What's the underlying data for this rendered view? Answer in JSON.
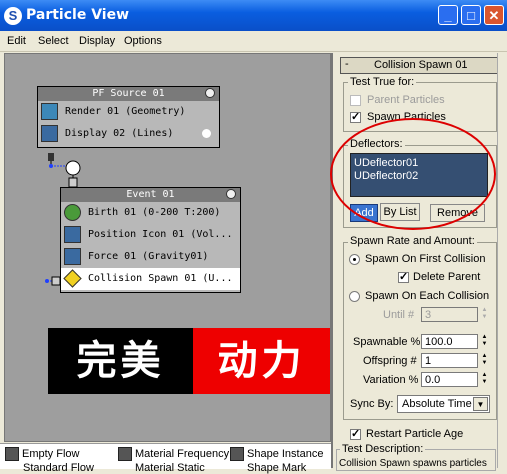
{
  "window": {
    "title": "Particle View",
    "app_icon": "3ds-max-logo"
  },
  "menu": [
    "Edit",
    "Select",
    "Display",
    "Options"
  ],
  "nodes": {
    "source": {
      "title": "PF Source 01",
      "rows": [
        "Render 01 (Geometry)",
        "Display 02 (Lines)"
      ]
    },
    "event": {
      "title": "Event 01",
      "rows": [
        "Birth 01 (0-200 T:200)",
        "Position Icon 01 (Vol...",
        "Force 01 (Gravity01)",
        "Collision Spawn 01 (U..."
      ]
    }
  },
  "banner": {
    "left_text": "完美",
    "right_text": "动力"
  },
  "depot": {
    "items": [
      "Empty Flow",
      "Material Frequency",
      "Shape Instance"
    ],
    "items_row2": [
      "Standard Flow",
      "Material Static",
      "Shape Mark"
    ]
  },
  "panel": {
    "rollout_title": "Collision Spawn 01",
    "rollout_sign": "-",
    "test_true_for": {
      "label": "Test True for:",
      "parent": "Parent Particles",
      "spawn": "Spawn Particles"
    },
    "deflectors": {
      "label": "Deflectors:",
      "items": [
        "UDeflector01",
        "UDeflector02"
      ],
      "add": "Add",
      "by_list": "By List",
      "remove": "Remove"
    },
    "spawn_rate": {
      "label": "Spawn Rate and Amount:",
      "first_collision": "Spawn On First Collision",
      "delete_parent": "Delete Parent",
      "each_collision": "Spawn On Each Collision",
      "until_label": "Until #",
      "until_value": "3",
      "spawnable_label": "Spawnable %",
      "spawnable_value": "100.0",
      "offspring_label": "Offspring #",
      "offspring_value": "1",
      "variation_label": "Variation %",
      "variation_value": "0.0",
      "sync_label": "Sync By:",
      "sync_value": "Absolute Time"
    },
    "restart": "Restart Particle Age",
    "test_description": {
      "label": "Test Description:",
      "text": "Collision Spawn spawns particles"
    }
  },
  "colors": {
    "titlebar": "#0a5ee0",
    "deflector_list": "#354f72",
    "highlight_ellipse": "#dd0000",
    "banner_black": "#000000",
    "banner_red": "#ee0000"
  }
}
